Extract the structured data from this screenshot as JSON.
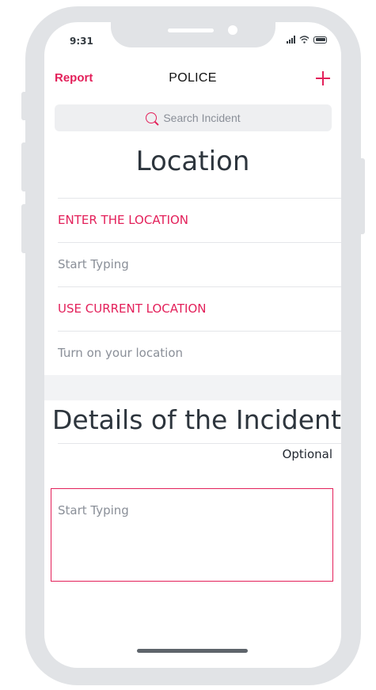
{
  "status_bar": {
    "time": "9:31",
    "icons": [
      "signal-icon",
      "wifi-icon",
      "battery-icon"
    ]
  },
  "nav": {
    "left_label": "Report",
    "title": "POLICE",
    "right_icon": "plus-icon"
  },
  "search": {
    "placeholder": "Search Incident"
  },
  "location": {
    "heading": "Location",
    "rows": [
      {
        "label": "ENTER THE LOCATION"
      },
      {
        "label": "Start Typing"
      },
      {
        "label": "USE CURRENT LOCATION"
      },
      {
        "label": "Turn on your location"
      }
    ]
  },
  "details": {
    "heading": "Details of the Incident",
    "optional_label": "Optional",
    "placeholder": "Start Typing"
  },
  "colors": {
    "accent": "#e3205a",
    "text": "#2d353d",
    "muted": "#8a8f98",
    "frame": "#e1e3e6"
  }
}
